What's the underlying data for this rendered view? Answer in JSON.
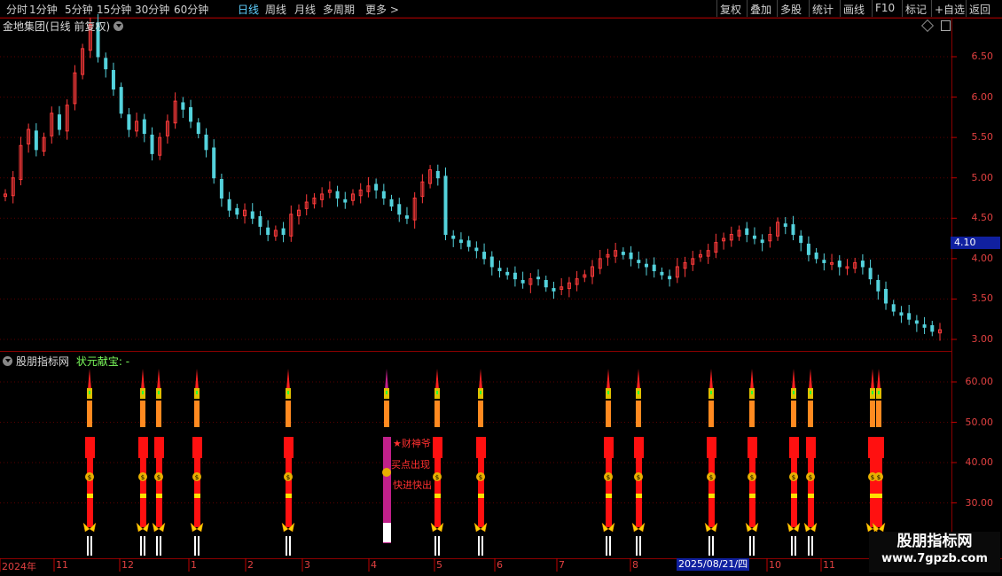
{
  "toolbar": {
    "left_items": [
      {
        "label": "分时",
        "active": false
      },
      {
        "label": "1分钟",
        "active": false
      },
      {
        "label": "5分钟",
        "active": false
      },
      {
        "label": "15分钟",
        "active": false
      },
      {
        "label": "30分钟",
        "active": false
      },
      {
        "label": "60分钟",
        "active": false
      },
      {
        "label": "日线",
        "active": true
      },
      {
        "label": "周线",
        "active": false
      },
      {
        "label": "月线",
        "active": false
      },
      {
        "label": "多周期",
        "active": false
      },
      {
        "label": "更多 >",
        "active": false
      }
    ],
    "right_items": [
      "复权",
      "叠加",
      "多股",
      "统计",
      "画线",
      "F10",
      "标记",
      "+自选",
      "返回"
    ]
  },
  "main_chart": {
    "title": "金地集团(日线 前复权)",
    "y_ticks": [
      "6.50",
      "6.00",
      "5.50",
      "5.00",
      "4.50",
      "4.00",
      "3.50",
      "3.00"
    ],
    "current_price": "4.10",
    "colors": {
      "up": "#ff3b3b",
      "down": "#54d2dc",
      "grid": "#5a0000"
    }
  },
  "indicator": {
    "source_name": "股朋指标网",
    "indicator_name": "状元献宝: -",
    "y_ticks": [
      "60.00",
      "50.00",
      "40.00",
      "30.00"
    ],
    "annotations": [
      "★财神爷",
      "买点出现",
      "快进快出"
    ]
  },
  "date_axis": {
    "labels": [
      "2024年",
      "11",
      "12",
      "1",
      "2",
      "3",
      "4",
      "5",
      "6",
      "7",
      "8",
      "9",
      "10",
      "11"
    ],
    "cursor_date": "2025/08/21/四"
  },
  "watermark": {
    "name": "股朋指标网",
    "url": "www.7gpzb.com"
  },
  "chart_data": {
    "type": "candlestick",
    "title": "金地集团(日线 前复权)",
    "ylim": [
      2.95,
      6.75
    ],
    "closes": [
      4.8,
      5.0,
      5.4,
      5.6,
      5.35,
      5.5,
      5.8,
      5.6,
      5.9,
      6.3,
      6.6,
      6.9,
      6.5,
      6.35,
      6.1,
      5.8,
      5.6,
      5.7,
      5.55,
      5.3,
      5.5,
      5.7,
      5.95,
      5.85,
      5.7,
      5.55,
      5.35,
      5.0,
      4.75,
      4.6,
      4.55,
      4.6,
      4.5,
      4.4,
      4.3,
      4.35,
      4.3,
      4.55,
      4.6,
      4.7,
      4.75,
      4.8,
      4.85,
      4.75,
      4.7,
      4.8,
      4.85,
      4.9,
      4.85,
      4.75,
      4.65,
      4.55,
      4.5,
      4.75,
      4.95,
      5.1,
      5.0,
      4.3,
      4.25,
      4.2,
      4.15,
      4.1,
      4.0,
      3.9,
      3.85,
      3.8,
      3.75,
      3.7,
      3.75,
      3.75,
      3.65,
      3.6,
      3.65,
      3.7,
      3.75,
      3.8,
      3.9,
      4.0,
      4.05,
      4.1,
      4.05,
      4.0,
      3.95,
      3.9,
      3.85,
      3.8,
      3.75,
      3.9,
      3.95,
      4.0,
      4.05,
      4.1,
      4.2,
      4.25,
      4.3,
      4.35,
      4.3,
      4.25,
      4.2,
      4.3,
      4.45,
      4.4,
      4.3,
      4.2,
      4.05,
      4.0,
      3.95,
      3.95,
      3.9,
      3.9,
      3.95,
      3.9,
      3.75,
      3.6,
      3.45,
      3.35,
      3.3,
      3.25,
      3.2,
      3.15,
      3.1,
      3.12
    ]
  }
}
